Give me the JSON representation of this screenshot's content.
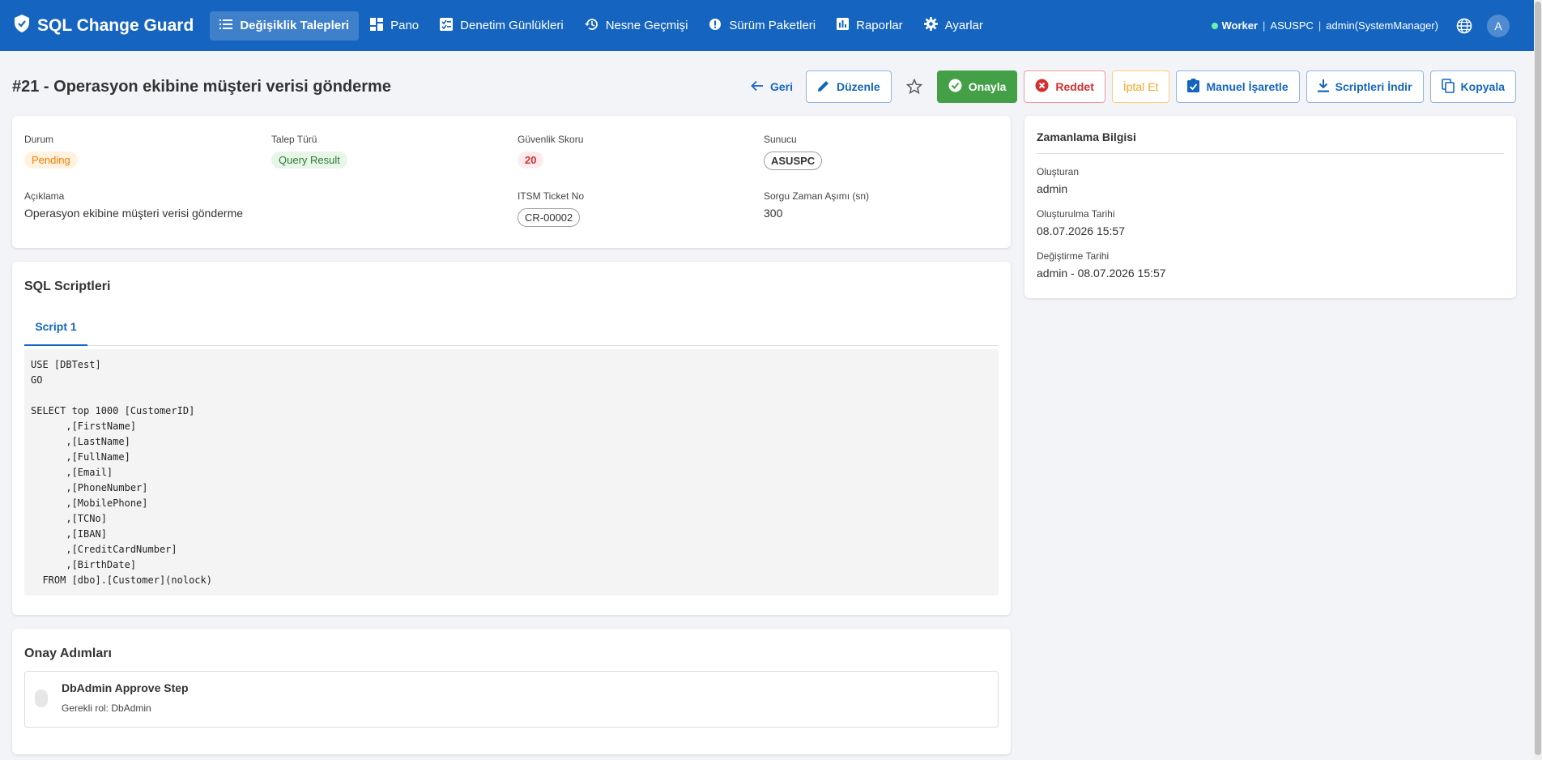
{
  "app": {
    "title": "SQL Change Guard",
    "nav": [
      {
        "label": "Değişiklik Talepleri",
        "icon": "list-icon",
        "active": true
      },
      {
        "label": "Pano",
        "icon": "dashboard-icon",
        "active": false
      },
      {
        "label": "Denetim Günlükleri",
        "icon": "audit-log-icon",
        "active": false
      },
      {
        "label": "Nesne Geçmişi",
        "icon": "history-icon",
        "active": false
      },
      {
        "label": "Sürüm Paketleri",
        "icon": "package-icon",
        "active": false
      },
      {
        "label": "Raporlar",
        "icon": "bar-chart-icon",
        "active": false
      },
      {
        "label": "Ayarlar",
        "icon": "gear-icon",
        "active": false
      }
    ],
    "worker_label": "Worker",
    "server": "ASUSPC",
    "user": "admin(SystemManager)",
    "avatar_letter": "A",
    "status_color": "#69f0ae",
    "brand_color": "#1565c0"
  },
  "page": {
    "title": "#21 - Operasyon ekibine müşteri verisi gönderme",
    "actions": {
      "back": "Geri",
      "edit": "Düzenle",
      "approve": "Onayla",
      "reject": "Reddet",
      "cancel": "İptal Et",
      "manual_mark": "Manuel İşaretle",
      "download_scripts": "Scriptleri İndir",
      "copy": "Kopyala"
    }
  },
  "info": {
    "status_label": "Durum",
    "status_value": "Pending",
    "type_label": "Talep Türü",
    "type_value": "Query Result",
    "security_label": "Güvenlik Skoru",
    "security_value": "20",
    "server_label": "Sunucu",
    "server_value": "ASUSPC",
    "description_label": "Açıklama",
    "description_value": "Operasyon ekibine müşteri verisi gönderme",
    "itsm_label": "ITSM Ticket No",
    "itsm_value": "CR-00002",
    "timeout_label": "Sorgu Zaman Aşımı (sn)",
    "timeout_value": "300"
  },
  "timing": {
    "title": "Zamanlama Bilgisi",
    "created_by_label": "Oluşturan",
    "created_by": "admin",
    "created_at_label": "Oluşturulma Tarihi",
    "created_at": "08.07.2026 15:57",
    "modified_label": "Değiştirme Tarihi",
    "modified": "admin - 08.07.2026 15:57"
  },
  "sql": {
    "title": "SQL Scriptleri",
    "tabs": [
      "Script 1"
    ],
    "code": "USE [DBTest]\nGO\n\nSELECT top 1000 [CustomerID]\n      ,[FirstName]\n      ,[LastName]\n      ,[FullName]\n      ,[Email]\n      ,[PhoneNumber]\n      ,[MobilePhone]\n      ,[TCNo]\n      ,[IBAN]\n      ,[CreditCardNumber]\n      ,[BirthDate]\n  FROM [dbo].[Customer](nolock)"
  },
  "approval": {
    "title": "Onay Adımları",
    "steps": [
      {
        "name": "DbAdmin Approve Step",
        "role": "Gerekli rol: DbAdmin"
      }
    ]
  }
}
